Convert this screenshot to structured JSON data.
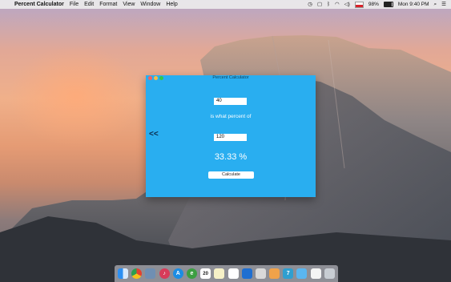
{
  "menubar": {
    "apple": "",
    "app_name": "Percent Calculator",
    "menus": [
      "File",
      "Edit",
      "Format",
      "View",
      "Window",
      "Help"
    ],
    "battery": "98%",
    "clock": "Mon 9:40 PM"
  },
  "window": {
    "title": "Percent Calculator",
    "value_a": "40",
    "middle_label": "is what percent of",
    "value_b": "120",
    "result": "33.33 %",
    "calculate_label": "Calculate",
    "back_label": "<<"
  },
  "dock": {
    "icons": [
      "finder-icon",
      "chrome-icon",
      "photo-icon",
      "safari-icon",
      "music-icon",
      "app-store-icon",
      "evernote-icon",
      "calendar-icon",
      "notes-icon",
      "reminders-icon",
      "xcode-icon",
      "pages-icon",
      "numbers-icon",
      "keynote-icon",
      "folder-icon",
      "document-icon",
      "trash-icon"
    ],
    "calendar_day": "20",
    "app_seven": "7"
  },
  "colors": {
    "window_bg": "#29aef0",
    "close": "#fc605c",
    "minimize": "#fdbc40",
    "maximize": "#34c84a"
  }
}
